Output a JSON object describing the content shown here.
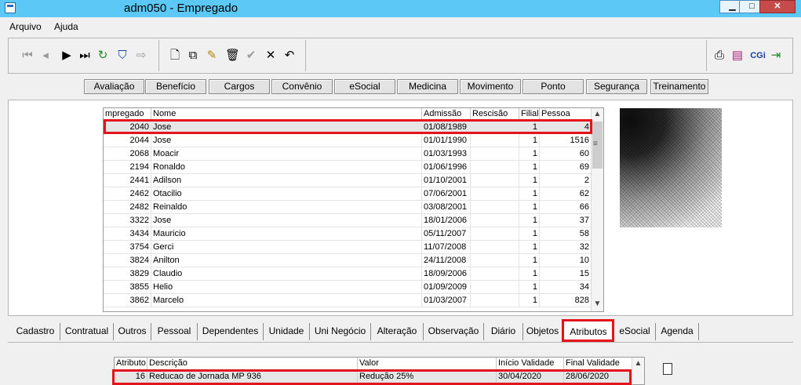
{
  "window": {
    "title": "adm050 - Empregado",
    "min": "▁",
    "max": "□",
    "close": "✕"
  },
  "menu": {
    "arquivo": "Arquivo",
    "ajuda": "Ajuda"
  },
  "toolbar": {
    "cgi": "CGi"
  },
  "modules": [
    "Avaliação",
    "Benefício",
    "Cargos",
    "Convênio",
    "eSocial",
    "Medicina",
    "Movimento",
    "Ponto",
    "Segurança",
    "Treinamento"
  ],
  "employees": {
    "columns": [
      "mpregado",
      "Nome",
      "Admissão",
      "Rescisão",
      "Filial",
      "Pessoa"
    ],
    "rows": [
      {
        "id": "2040",
        "nome": "Jose",
        "admissao": "01/08/1989",
        "rescisao": "",
        "filial": "1",
        "pessoa": "4"
      },
      {
        "id": "2044",
        "nome": "Jose",
        "admissao": "01/01/1990",
        "rescisao": "",
        "filial": "1",
        "pessoa": "1516"
      },
      {
        "id": "2068",
        "nome": "Moacir",
        "admissao": "01/03/1993",
        "rescisao": "",
        "filial": "1",
        "pessoa": "60"
      },
      {
        "id": "2194",
        "nome": "Ronaldo",
        "admissao": "01/06/1996",
        "rescisao": "",
        "filial": "1",
        "pessoa": "69"
      },
      {
        "id": "2441",
        "nome": "Adilson",
        "admissao": "01/10/2001",
        "rescisao": "",
        "filial": "1",
        "pessoa": "2"
      },
      {
        "id": "2462",
        "nome": "Otacilio",
        "admissao": "07/06/2001",
        "rescisao": "",
        "filial": "1",
        "pessoa": "62"
      },
      {
        "id": "2482",
        "nome": "Reinaldo",
        "admissao": "03/08/2001",
        "rescisao": "",
        "filial": "1",
        "pessoa": "66"
      },
      {
        "id": "3322",
        "nome": "Jose",
        "admissao": "18/01/2006",
        "rescisao": "",
        "filial": "1",
        "pessoa": "37"
      },
      {
        "id": "3434",
        "nome": "Mauricio",
        "admissao": "05/11/2007",
        "rescisao": "",
        "filial": "1",
        "pessoa": "58"
      },
      {
        "id": "3754",
        "nome": "Gerci",
        "admissao": "11/07/2008",
        "rescisao": "",
        "filial": "1",
        "pessoa": "32"
      },
      {
        "id": "3824",
        "nome": "Anilton",
        "admissao": "24/11/2008",
        "rescisao": "",
        "filial": "1",
        "pessoa": "10"
      },
      {
        "id": "3829",
        "nome": "Claudio",
        "admissao": "18/09/2006",
        "rescisao": "",
        "filial": "1",
        "pessoa": "15"
      },
      {
        "id": "3855",
        "nome": "Helio",
        "admissao": "01/09/2009",
        "rescisao": "",
        "filial": "1",
        "pessoa": "34"
      },
      {
        "id": "3862",
        "nome": "Marcelo",
        "admissao": "01/03/2007",
        "rescisao": "",
        "filial": "1",
        "pessoa": "828"
      }
    ]
  },
  "tabs": [
    "Cadastro",
    "Contratual",
    "Outros",
    "Pessoal",
    "Dependentes",
    "Unidade",
    "Uni Negócio",
    "Alteração",
    "Observação",
    "Diário",
    "Objetos",
    "Atributos",
    "eSocial",
    "Agenda"
  ],
  "active_tab": "Atributos",
  "attributes": {
    "columns": [
      "Atributo",
      "Descrição",
      "Valor",
      "Início Validade",
      "Final Validade"
    ],
    "rows": [
      {
        "atributo": "16",
        "descricao": "Reducao de Jornada MP 936",
        "valor": "Redução 25%",
        "inicio": "30/04/2020",
        "final": "28/06/2020"
      }
    ]
  },
  "highlight_color": "#e3141c"
}
